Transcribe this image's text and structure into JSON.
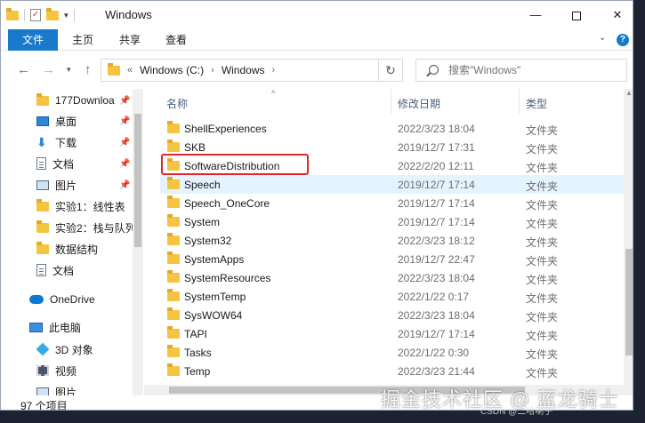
{
  "window": {
    "title": "Windows",
    "minimize": "—",
    "close": "✕"
  },
  "ribbon": {
    "tabs": [
      "文件",
      "主页",
      "共享",
      "查看"
    ],
    "expand_glyph": "⌄",
    "help_glyph": "?"
  },
  "address": {
    "parts": [
      "Windows (C:)",
      "Windows"
    ],
    "prefix": "«",
    "chevron": "›",
    "search_placeholder": "搜索\"Windows\""
  },
  "nav_pane": {
    "quick_access": [
      {
        "label": "177Downloa",
        "icon": "folder-icon",
        "pinned": true
      },
      {
        "label": "桌面",
        "icon": "desktop-icon",
        "pinned": true
      },
      {
        "label": "下载",
        "icon": "download-icon",
        "pinned": true
      },
      {
        "label": "文档",
        "icon": "document-icon",
        "pinned": true
      },
      {
        "label": "图片",
        "icon": "picture-icon",
        "pinned": true
      },
      {
        "label": "实验1：线性表",
        "icon": "folder-icon",
        "pinned": false
      },
      {
        "label": "实验2：栈与队列",
        "icon": "folder-icon",
        "pinned": false
      },
      {
        "label": "数据结构",
        "icon": "folder-icon",
        "pinned": false
      },
      {
        "label": "文档",
        "icon": "document-icon",
        "pinned": false
      }
    ],
    "onedrive": {
      "label": "OneDrive",
      "icon": "onedrive-icon"
    },
    "this_pc": [
      {
        "label": "此电脑",
        "icon": "this-pc-icon"
      },
      {
        "label": "3D 对象",
        "icon": "3d-objects-icon"
      },
      {
        "label": "视频",
        "icon": "video-icon"
      },
      {
        "label": "图片",
        "icon": "picture-icon"
      }
    ]
  },
  "columns": {
    "name": "名称",
    "date": "修改日期",
    "type": "类型"
  },
  "files": [
    {
      "name": "ShellExperiences",
      "date": "2022/3/23 18:04",
      "type": "文件夹"
    },
    {
      "name": "SKB",
      "date": "2019/12/7 17:31",
      "type": "文件夹"
    },
    {
      "name": "SoftwareDistribution",
      "date": "2022/2/20 12:11",
      "type": "文件夹"
    },
    {
      "name": "Speech",
      "date": "2019/12/7 17:14",
      "type": "文件夹"
    },
    {
      "name": "Speech_OneCore",
      "date": "2019/12/7 17:14",
      "type": "文件夹"
    },
    {
      "name": "System",
      "date": "2019/12/7 17:14",
      "type": "文件夹"
    },
    {
      "name": "System32",
      "date": "2022/3/23 18:12",
      "type": "文件夹"
    },
    {
      "name": "SystemApps",
      "date": "2019/12/7 22:47",
      "type": "文件夹"
    },
    {
      "name": "SystemResources",
      "date": "2022/3/23 18:04",
      "type": "文件夹"
    },
    {
      "name": "SystemTemp",
      "date": "2022/1/22 0:17",
      "type": "文件夹"
    },
    {
      "name": "SysWOW64",
      "date": "2022/3/23 18:04",
      "type": "文件夹"
    },
    {
      "name": "TAPI",
      "date": "2019/12/7 17:14",
      "type": "文件夹"
    },
    {
      "name": "Tasks",
      "date": "2022/1/22 0:30",
      "type": "文件夹"
    },
    {
      "name": "Temp",
      "date": "2022/3/23 21:44",
      "type": "文件夹"
    }
  ],
  "hover_row": "Speech",
  "highlighted_row": "SoftwareDistribution",
  "status": {
    "item_count": "97 个项目"
  },
  "watermark": {
    "text": "掘金技术社区 @ 蓝龙骑士",
    "sub": "CSDN @二哈喇子"
  },
  "colors": {
    "accent": "#1979ca",
    "highlight": "#e0272a",
    "hover": "#e5f3ff",
    "folder": "#f5c542"
  }
}
